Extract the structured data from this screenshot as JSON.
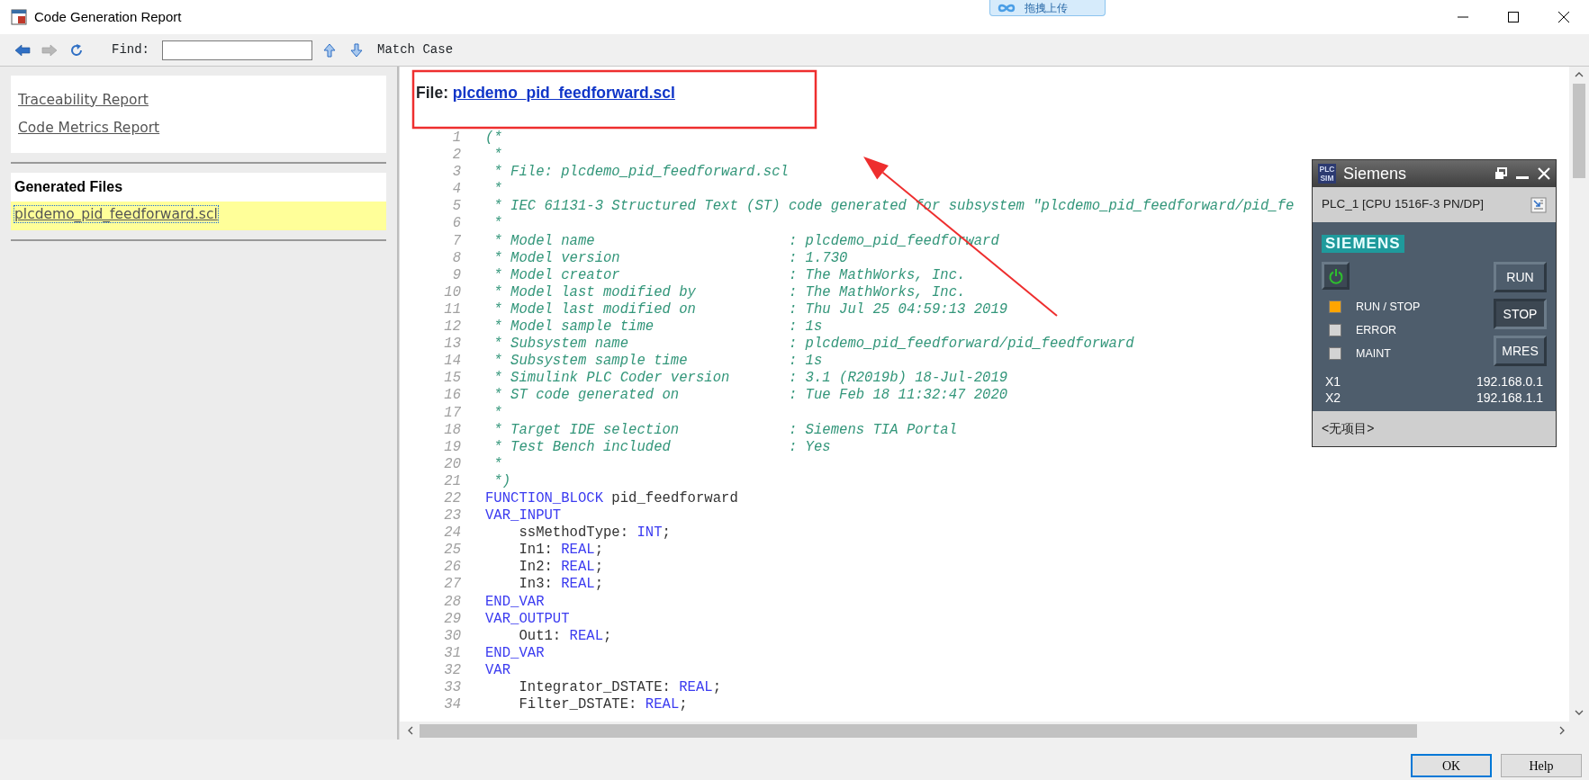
{
  "window": {
    "title": "Code Generation Report",
    "controls": [
      {
        "kind": "minimize"
      },
      {
        "kind": "maximize"
      },
      {
        "kind": "close"
      }
    ]
  },
  "upload_widget": {
    "label": "拖拽上传"
  },
  "toolbar": {
    "nav_buttons": [
      {
        "kind": "back",
        "disabled": false
      },
      {
        "kind": "forward",
        "disabled": true
      },
      {
        "kind": "refresh",
        "disabled": false
      }
    ],
    "find_label": "Find:",
    "find_buttons": [
      {
        "kind": "up"
      },
      {
        "kind": "down"
      }
    ],
    "match_case": "Match Case"
  },
  "sidebar": {
    "reports": [
      {
        "label": "Traceability Report"
      },
      {
        "label": "Code Metrics Report"
      }
    ],
    "generated_files": {
      "title": "Generated Files",
      "items": [
        {
          "label": "plcdemo_pid_feedforward.scl",
          "selected": true
        }
      ]
    }
  },
  "report": {
    "file_label": "File:",
    "file_name": "plcdemo_pid_feedforward.scl",
    "lines": [
      {
        "number": "1",
        "segments": [
          {
            "kind": "comment",
            "text": "(*"
          }
        ]
      },
      {
        "number": "2",
        "segments": [
          {
            "kind": "comment",
            "text": " *"
          }
        ]
      },
      {
        "number": "3",
        "segments": [
          {
            "kind": "comment",
            "text": " * File: plcdemo_pid_feedforward.scl"
          }
        ]
      },
      {
        "number": "4",
        "segments": [
          {
            "kind": "comment",
            "text": " *"
          }
        ]
      },
      {
        "number": "5",
        "segments": [
          {
            "kind": "comment",
            "text": " * IEC 61131-3 Structured Text (ST) code generated for subsystem \"plcdemo_pid_feedforward/pid_fe"
          }
        ]
      },
      {
        "number": "6",
        "segments": [
          {
            "kind": "comment",
            "text": " *"
          }
        ]
      },
      {
        "number": "7",
        "segments": [
          {
            "kind": "comment",
            "text": " * Model name                       : plcdemo_pid_feedforward"
          }
        ]
      },
      {
        "number": "8",
        "segments": [
          {
            "kind": "comment",
            "text": " * Model version                    : 1.730"
          }
        ]
      },
      {
        "number": "9",
        "segments": [
          {
            "kind": "comment",
            "text": " * Model creator                    : The MathWorks, Inc."
          }
        ]
      },
      {
        "number": "10",
        "segments": [
          {
            "kind": "comment",
            "text": " * Model last modified by           : The MathWorks, Inc."
          }
        ]
      },
      {
        "number": "11",
        "segments": [
          {
            "kind": "comment",
            "text": " * Model last modified on           : Thu Jul 25 04:59:13 2019"
          }
        ]
      },
      {
        "number": "12",
        "segments": [
          {
            "kind": "comment",
            "text": " * Model sample time                : 1s"
          }
        ]
      },
      {
        "number": "13",
        "segments": [
          {
            "kind": "comment",
            "text": " * Subsystem name                   : plcdemo_pid_feedforward/pid_feedforward"
          }
        ]
      },
      {
        "number": "14",
        "segments": [
          {
            "kind": "comment",
            "text": " * Subsystem sample time            : 1s"
          }
        ]
      },
      {
        "number": "15",
        "segments": [
          {
            "kind": "comment",
            "text": " * Simulink PLC Coder version       : 3.1 (R2019b) 18-Jul-2019"
          }
        ]
      },
      {
        "number": "16",
        "segments": [
          {
            "kind": "comment",
            "text": " * ST code generated on             : Tue Feb 18 11:32:47 2020"
          }
        ]
      },
      {
        "number": "17",
        "segments": [
          {
            "kind": "comment",
            "text": " *"
          }
        ]
      },
      {
        "number": "18",
        "segments": [
          {
            "kind": "comment",
            "text": " * Target IDE selection             : Siemens TIA Portal"
          }
        ]
      },
      {
        "number": "19",
        "segments": [
          {
            "kind": "comment",
            "text": " * Test Bench included              : Yes"
          }
        ]
      },
      {
        "number": "20",
        "segments": [
          {
            "kind": "comment",
            "text": " *"
          }
        ]
      },
      {
        "number": "21",
        "segments": [
          {
            "kind": "comment",
            "text": " *)"
          }
        ]
      },
      {
        "number": "22",
        "segments": [
          {
            "kind": "keyword",
            "text": "FUNCTION_BLOCK"
          },
          {
            "kind": "plain",
            "text": " pid_feedforward"
          }
        ]
      },
      {
        "number": "23",
        "segments": [
          {
            "kind": "keyword",
            "text": "VAR_INPUT"
          }
        ]
      },
      {
        "number": "24",
        "segments": [
          {
            "kind": "plain",
            "text": "    ssMethodType: "
          },
          {
            "kind": "keyword",
            "text": "INT"
          },
          {
            "kind": "plain",
            "text": ";"
          }
        ]
      },
      {
        "number": "25",
        "segments": [
          {
            "kind": "plain",
            "text": "    In1: "
          },
          {
            "kind": "keyword",
            "text": "REAL"
          },
          {
            "kind": "plain",
            "text": ";"
          }
        ]
      },
      {
        "number": "26",
        "segments": [
          {
            "kind": "plain",
            "text": "    In2: "
          },
          {
            "kind": "keyword",
            "text": "REAL"
          },
          {
            "kind": "plain",
            "text": ";"
          }
        ]
      },
      {
        "number": "27",
        "segments": [
          {
            "kind": "plain",
            "text": "    In3: "
          },
          {
            "kind": "keyword",
            "text": "REAL"
          },
          {
            "kind": "plain",
            "text": ";"
          }
        ]
      },
      {
        "number": "28",
        "segments": [
          {
            "kind": "keyword",
            "text": "END_VAR"
          }
        ]
      },
      {
        "number": "29",
        "segments": [
          {
            "kind": "keyword",
            "text": "VAR_OUTPUT"
          }
        ]
      },
      {
        "number": "30",
        "segments": [
          {
            "kind": "plain",
            "text": "    Out1: "
          },
          {
            "kind": "keyword",
            "text": "REAL"
          },
          {
            "kind": "plain",
            "text": ";"
          }
        ]
      },
      {
        "number": "31",
        "segments": [
          {
            "kind": "keyword",
            "text": "END_VAR"
          }
        ]
      },
      {
        "number": "32",
        "segments": [
          {
            "kind": "keyword",
            "text": "VAR"
          }
        ]
      },
      {
        "number": "33",
        "segments": [
          {
            "kind": "plain",
            "text": "    Integrator_DSTATE: "
          },
          {
            "kind": "keyword",
            "text": "REAL"
          },
          {
            "kind": "plain",
            "text": ";"
          }
        ]
      },
      {
        "number": "34",
        "segments": [
          {
            "kind": "plain",
            "text": "    Filter_DSTATE: "
          },
          {
            "kind": "keyword",
            "text": "REAL"
          },
          {
            "kind": "plain",
            "text": ";"
          }
        ]
      }
    ]
  },
  "plcsim": {
    "icon_text": [
      "PLC",
      "SIM"
    ],
    "title": "Siemens",
    "window_controls": [
      {
        "kind": "restore"
      },
      {
        "kind": "minimize"
      },
      {
        "kind": "close"
      }
    ],
    "device": "PLC_1 [CPU 1516F-3 PN/DP]",
    "logo": "SIEMENS",
    "power_on": true,
    "leds": [
      {
        "label": "RUN / STOP",
        "color": "#ffa500"
      },
      {
        "label": "ERROR",
        "color": "#d3d3d3"
      },
      {
        "label": "MAINT",
        "color": "#d3d3d3"
      }
    ],
    "mode_buttons": [
      {
        "label": "RUN",
        "selected": false
      },
      {
        "label": "STOP",
        "selected": true
      },
      {
        "label": "MRES",
        "selected": false
      }
    ],
    "interfaces": [
      {
        "name": "X1",
        "address": "192.168.0.1"
      },
      {
        "name": "X2",
        "address": "192.168.1.1"
      }
    ],
    "project": "<无项目>"
  },
  "dialog_buttons": [
    {
      "label": "OK",
      "default": true
    },
    {
      "label": "Help",
      "default": false
    }
  ],
  "annotations": [
    {
      "kind": "box"
    },
    {
      "kind": "arrow"
    }
  ]
}
